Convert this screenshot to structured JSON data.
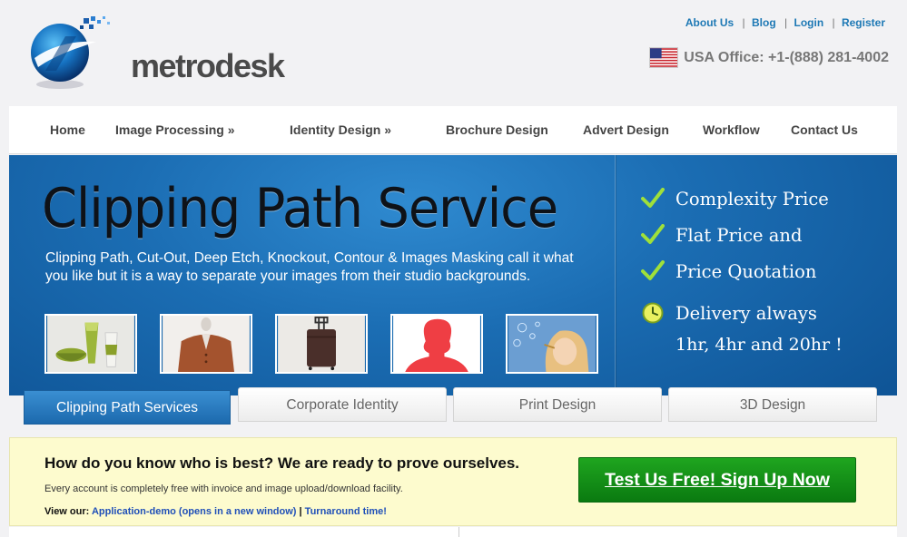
{
  "brand": {
    "name": "metrodesk"
  },
  "top_links": [
    "About Us",
    "Blog",
    "Login",
    "Register"
  ],
  "office": {
    "text": "USA Office: +1-(888) 281-4002"
  },
  "nav": [
    "Home",
    "Image Processing »",
    "Identity Design »",
    "Brochure Design",
    "Advert Design",
    "Workflow",
    "Contact Us"
  ],
  "hero": {
    "title": "Clipping Path Service",
    "subtitle": "Clipping Path, Cut-Out, Deep Etch, Knockout, Contour & Images Masking call it what you like but it is a way to separate your images from their studio backgrounds.",
    "features": [
      "Complexity Price",
      "Flat Price and",
      "Price Quotation",
      "Delivery always"
    ],
    "delivery_times": "1hr, 4hr and 20hr !"
  },
  "tabs": [
    "Clipping Path Services",
    "Corporate Identity",
    "Print Design",
    "3D Design"
  ],
  "promo": {
    "heading": "How do you know who is best? We are ready to prove ourselves.",
    "description": "Every account is completely free with invoice and image upload/download facility.",
    "view_label": "View our:",
    "link_demo": "Application-demo (opens in a new window)",
    "link_separator": "|",
    "link_turnaround": "Turnaround time!",
    "cta": "Test Us Free! Sign Up Now"
  },
  "icons": {
    "feature_check": "check-icon",
    "feature_clock": "clock-icon",
    "office_flag": "us-flag-icon"
  },
  "colors": {
    "link_blue": "#1e79b5",
    "hero_blue": "#1b6db3",
    "cta_green": "#10901a",
    "promo_bg": "#fdfbce"
  }
}
